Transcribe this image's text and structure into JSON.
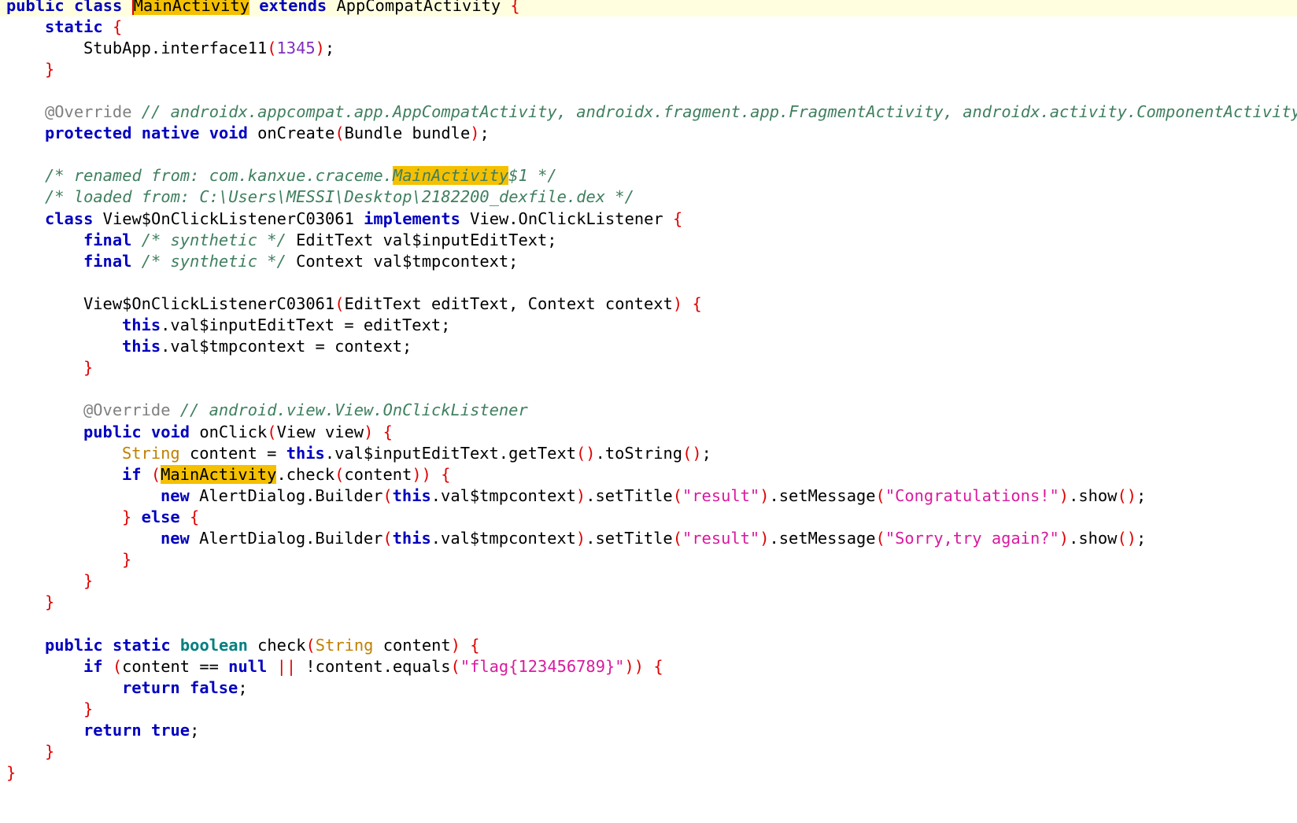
{
  "editor": {
    "lines": [
      {
        "indent": 0,
        "current": true,
        "tokens": [
          {
            "t": "public",
            "c": "k"
          },
          {
            "t": " "
          },
          {
            "t": "class",
            "c": "k"
          },
          {
            "t": " "
          },
          {
            "t": "MainActivity",
            "c": "pl",
            "hl": true,
            "caret": true
          },
          {
            "t": " "
          },
          {
            "t": "extends",
            "c": "k"
          },
          {
            "t": " AppCompatActivity "
          },
          {
            "t": "{",
            "c": "br"
          }
        ]
      },
      {
        "indent": 1,
        "tokens": [
          {
            "t": "static",
            "c": "k"
          },
          {
            "t": " "
          },
          {
            "t": "{",
            "c": "br"
          }
        ]
      },
      {
        "indent": 2,
        "tokens": [
          {
            "t": "StubApp.interface11"
          },
          {
            "t": "(",
            "c": "br"
          },
          {
            "t": "1345",
            "c": "nm"
          },
          {
            "t": ")",
            "c": "br"
          },
          {
            "t": ";"
          }
        ]
      },
      {
        "indent": 1,
        "tokens": [
          {
            "t": "}",
            "c": "br"
          }
        ]
      },
      {
        "indent": 0,
        "tokens": []
      },
      {
        "indent": 1,
        "tokens": [
          {
            "t": "@Override",
            "c": "an"
          },
          {
            "t": " "
          },
          {
            "t": "// androidx.appcompat.app.AppCompatActivity, androidx.fragment.app.FragmentActivity, androidx.activity.ComponentActivity",
            "c": "cm"
          }
        ]
      },
      {
        "indent": 1,
        "tokens": [
          {
            "t": "protected",
            "c": "k"
          },
          {
            "t": " "
          },
          {
            "t": "native",
            "c": "k"
          },
          {
            "t": " "
          },
          {
            "t": "void",
            "c": "k"
          },
          {
            "t": " onCreate"
          },
          {
            "t": "(",
            "c": "br"
          },
          {
            "t": "Bundle bundle"
          },
          {
            "t": ")",
            "c": "br"
          },
          {
            "t": ";"
          }
        ]
      },
      {
        "indent": 0,
        "tokens": []
      },
      {
        "indent": 1,
        "tokens": [
          {
            "t": "/* renamed from: com.kanxue.craceme.",
            "c": "cm"
          },
          {
            "t": "MainActivity",
            "c": "cm",
            "hl": true
          },
          {
            "t": "$1 */",
            "c": "cm"
          }
        ]
      },
      {
        "indent": 1,
        "tokens": [
          {
            "t": "/* loaded from: C:\\Users\\MESSI\\Desktop\\2182200_dexfile.dex */",
            "c": "cm"
          }
        ]
      },
      {
        "indent": 1,
        "tokens": [
          {
            "t": "class",
            "c": "k"
          },
          {
            "t": " View$OnClickListenerC03061 "
          },
          {
            "t": "implements",
            "c": "k"
          },
          {
            "t": " View.OnClickListener "
          },
          {
            "t": "{",
            "c": "br"
          }
        ]
      },
      {
        "indent": 2,
        "tokens": [
          {
            "t": "final",
            "c": "k"
          },
          {
            "t": " "
          },
          {
            "t": "/* synthetic */",
            "c": "cm"
          },
          {
            "t": " EditText val$inputEditText;"
          }
        ]
      },
      {
        "indent": 2,
        "tokens": [
          {
            "t": "final",
            "c": "k"
          },
          {
            "t": " "
          },
          {
            "t": "/* synthetic */",
            "c": "cm"
          },
          {
            "t": " Context val$tmpcontext;"
          }
        ]
      },
      {
        "indent": 0,
        "tokens": []
      },
      {
        "indent": 2,
        "tokens": [
          {
            "t": "View$OnClickListenerC03061"
          },
          {
            "t": "(",
            "c": "br"
          },
          {
            "t": "EditText editText, Context context"
          },
          {
            "t": ")",
            "c": "br"
          },
          {
            "t": " "
          },
          {
            "t": "{",
            "c": "br"
          }
        ]
      },
      {
        "indent": 3,
        "tokens": [
          {
            "t": "this",
            "c": "k"
          },
          {
            "t": ".val$inputEditText = editText;"
          }
        ]
      },
      {
        "indent": 3,
        "tokens": [
          {
            "t": "this",
            "c": "k"
          },
          {
            "t": ".val$tmpcontext = context;"
          }
        ]
      },
      {
        "indent": 2,
        "tokens": [
          {
            "t": "}",
            "c": "br"
          }
        ]
      },
      {
        "indent": 0,
        "tokens": []
      },
      {
        "indent": 2,
        "tokens": [
          {
            "t": "@Override",
            "c": "an"
          },
          {
            "t": " "
          },
          {
            "t": "// android.view.View.OnClickListener",
            "c": "cm"
          }
        ]
      },
      {
        "indent": 2,
        "tokens": [
          {
            "t": "public",
            "c": "k"
          },
          {
            "t": " "
          },
          {
            "t": "void",
            "c": "k"
          },
          {
            "t": " onClick"
          },
          {
            "t": "(",
            "c": "br"
          },
          {
            "t": "View view"
          },
          {
            "t": ")",
            "c": "br"
          },
          {
            "t": " "
          },
          {
            "t": "{",
            "c": "br"
          }
        ]
      },
      {
        "indent": 3,
        "tokens": [
          {
            "t": "String",
            "c": "ty"
          },
          {
            "t": " content = "
          },
          {
            "t": "this",
            "c": "k"
          },
          {
            "t": ".val$inputEditText.getText"
          },
          {
            "t": "()",
            "c": "br"
          },
          {
            "t": ".toString"
          },
          {
            "t": "()",
            "c": "br"
          },
          {
            "t": ";"
          }
        ]
      },
      {
        "indent": 3,
        "tokens": [
          {
            "t": "if",
            "c": "k"
          },
          {
            "t": " "
          },
          {
            "t": "(",
            "c": "br"
          },
          {
            "t": "MainActivity",
            "c": "pl",
            "hl": true
          },
          {
            "t": ".check"
          },
          {
            "t": "(",
            "c": "br"
          },
          {
            "t": "content"
          },
          {
            "t": "))",
            "c": "br"
          },
          {
            "t": " "
          },
          {
            "t": "{",
            "c": "br"
          }
        ]
      },
      {
        "indent": 4,
        "tokens": [
          {
            "t": "new",
            "c": "k"
          },
          {
            "t": " AlertDialog.Builder"
          },
          {
            "t": "(",
            "c": "br"
          },
          {
            "t": "this",
            "c": "k"
          },
          {
            "t": ".val$tmpcontext"
          },
          {
            "t": ")",
            "c": "br"
          },
          {
            "t": ".setTitle"
          },
          {
            "t": "(",
            "c": "br"
          },
          {
            "t": "\"result\"",
            "c": "st"
          },
          {
            "t": ")",
            "c": "br"
          },
          {
            "t": ".setMessage"
          },
          {
            "t": "(",
            "c": "br"
          },
          {
            "t": "\"Congratulations!\"",
            "c": "st"
          },
          {
            "t": ")",
            "c": "br"
          },
          {
            "t": ".show"
          },
          {
            "t": "()",
            "c": "br"
          },
          {
            "t": ";"
          }
        ]
      },
      {
        "indent": 3,
        "tokens": [
          {
            "t": "}",
            "c": "br"
          },
          {
            "t": " "
          },
          {
            "t": "else",
            "c": "k"
          },
          {
            "t": " "
          },
          {
            "t": "{",
            "c": "br"
          }
        ]
      },
      {
        "indent": 4,
        "tokens": [
          {
            "t": "new",
            "c": "k"
          },
          {
            "t": " AlertDialog.Builder"
          },
          {
            "t": "(",
            "c": "br"
          },
          {
            "t": "this",
            "c": "k"
          },
          {
            "t": ".val$tmpcontext"
          },
          {
            "t": ")",
            "c": "br"
          },
          {
            "t": ".setTitle"
          },
          {
            "t": "(",
            "c": "br"
          },
          {
            "t": "\"result\"",
            "c": "st"
          },
          {
            "t": ")",
            "c": "br"
          },
          {
            "t": ".setMessage"
          },
          {
            "t": "(",
            "c": "br"
          },
          {
            "t": "\"Sorry,try again?\"",
            "c": "st"
          },
          {
            "t": ")",
            "c": "br"
          },
          {
            "t": ".show"
          },
          {
            "t": "()",
            "c": "br"
          },
          {
            "t": ";"
          }
        ]
      },
      {
        "indent": 3,
        "tokens": [
          {
            "t": "}",
            "c": "br"
          }
        ]
      },
      {
        "indent": 2,
        "tokens": [
          {
            "t": "}",
            "c": "br"
          }
        ]
      },
      {
        "indent": 1,
        "tokens": [
          {
            "t": "}",
            "c": "br"
          }
        ]
      },
      {
        "indent": 0,
        "tokens": []
      },
      {
        "indent": 1,
        "tokens": [
          {
            "t": "public",
            "c": "k"
          },
          {
            "t": " "
          },
          {
            "t": "static",
            "c": "k"
          },
          {
            "t": " "
          },
          {
            "t": "boolean",
            "c": "bt"
          },
          {
            "t": " check"
          },
          {
            "t": "(",
            "c": "br"
          },
          {
            "t": "String",
            "c": "ty"
          },
          {
            "t": " content"
          },
          {
            "t": ")",
            "c": "br"
          },
          {
            "t": " "
          },
          {
            "t": "{",
            "c": "br"
          }
        ]
      },
      {
        "indent": 2,
        "tokens": [
          {
            "t": "if",
            "c": "k"
          },
          {
            "t": " "
          },
          {
            "t": "(",
            "c": "br"
          },
          {
            "t": "content == "
          },
          {
            "t": "null",
            "c": "k"
          },
          {
            "t": " "
          },
          {
            "t": "||",
            "c": "br"
          },
          {
            "t": " !content.equals"
          },
          {
            "t": "(",
            "c": "br"
          },
          {
            "t": "\"flag{123456789}\"",
            "c": "st"
          },
          {
            "t": "))",
            "c": "br"
          },
          {
            "t": " "
          },
          {
            "t": "{",
            "c": "br"
          }
        ]
      },
      {
        "indent": 3,
        "tokens": [
          {
            "t": "return",
            "c": "k"
          },
          {
            "t": " "
          },
          {
            "t": "false",
            "c": "k"
          },
          {
            "t": ";"
          }
        ]
      },
      {
        "indent": 2,
        "tokens": [
          {
            "t": "}",
            "c": "br"
          }
        ]
      },
      {
        "indent": 2,
        "tokens": [
          {
            "t": "return",
            "c": "k"
          },
          {
            "t": " "
          },
          {
            "t": "true",
            "c": "k"
          },
          {
            "t": ";"
          }
        ]
      },
      {
        "indent": 1,
        "tokens": [
          {
            "t": "}",
            "c": "br"
          }
        ]
      },
      {
        "indent": 0,
        "tokens": [
          {
            "t": "}",
            "c": "br"
          }
        ]
      }
    ]
  }
}
